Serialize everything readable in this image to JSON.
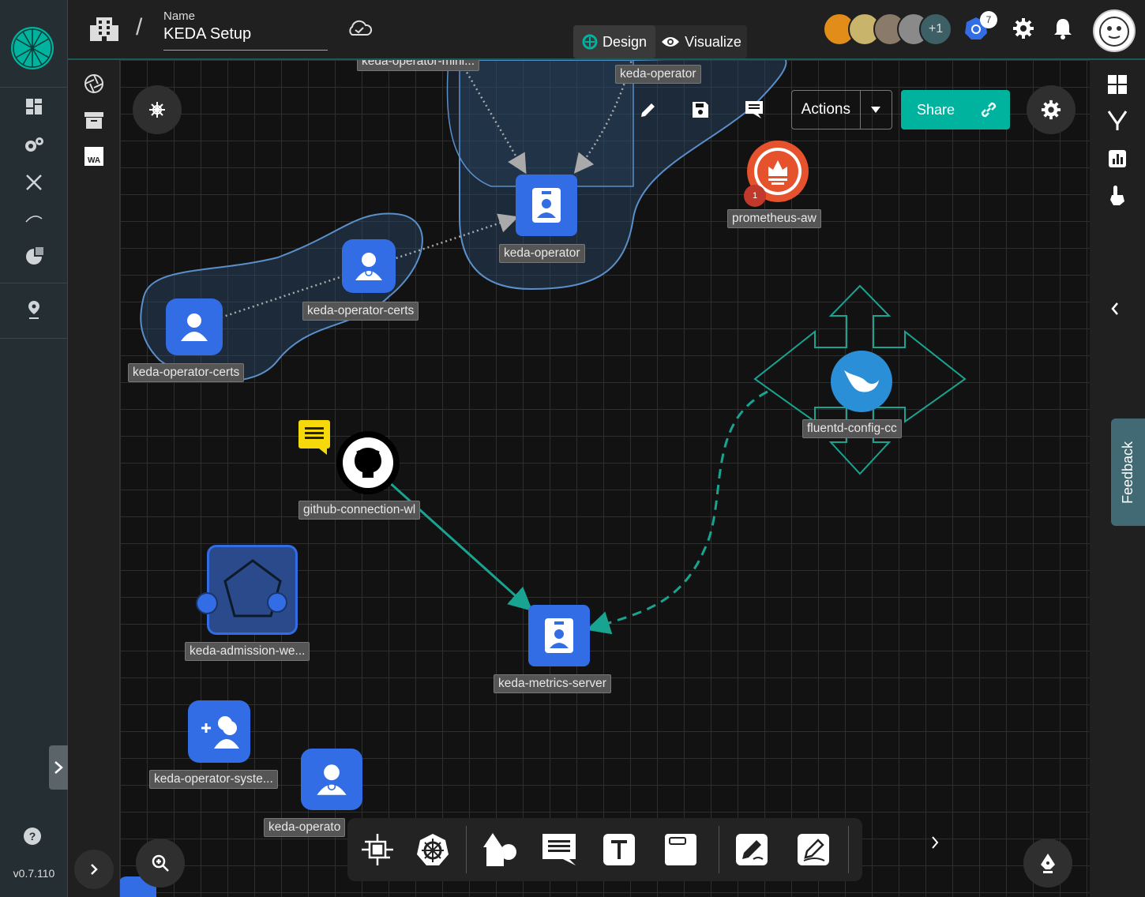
{
  "app": {
    "version": "v0.7.110",
    "feedback_label": "Feedback"
  },
  "header": {
    "name_label": "Name",
    "name_value": "KEDA Setup",
    "modes": [
      {
        "label": "Design",
        "active": true
      },
      {
        "label": "Visualize",
        "active": false
      }
    ],
    "collaborators_extra": "+1",
    "k8s_count": "7"
  },
  "toolbar": {
    "actions_label": "Actions",
    "share_label": "Share"
  },
  "canvas": {
    "nodes": [
      {
        "label": "keda-operator-mini..."
      },
      {
        "label": "keda-operator"
      },
      {
        "label": "keda-operator"
      },
      {
        "label": "prometheus-aw",
        "badge": "1"
      },
      {
        "label": "keda-operator-certs"
      },
      {
        "label": "keda-operator-certs"
      },
      {
        "label": "fluentd-config-cc"
      },
      {
        "label": "github-connection-wl"
      },
      {
        "label": "keda-admission-we..."
      },
      {
        "label": "keda-metrics-server"
      },
      {
        "label": "keda-operator-syste..."
      },
      {
        "label": "keda-operato"
      }
    ]
  },
  "toolcol": {
    "wa_label": "WA"
  },
  "colors": {
    "accent": "#00b39f",
    "node_blue": "#326de6",
    "prometheus": "#e6522c",
    "fluentd": "#2a8fd6"
  }
}
